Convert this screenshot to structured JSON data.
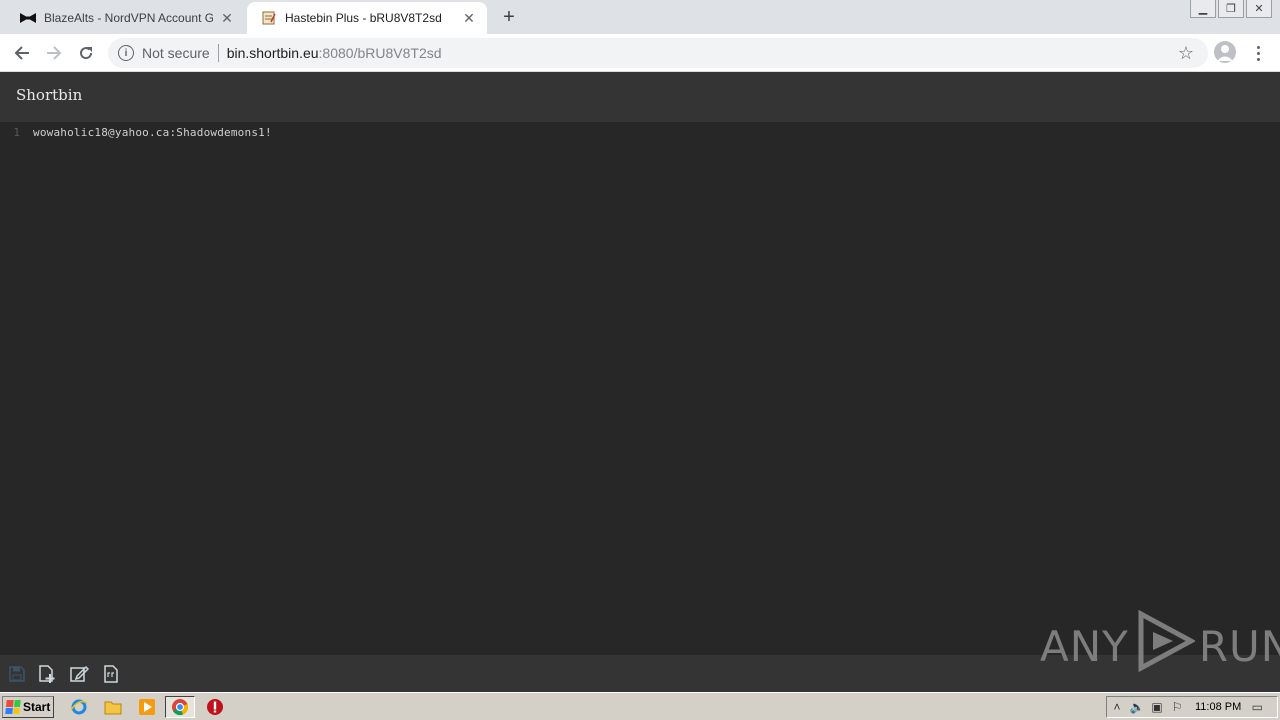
{
  "browser": {
    "tabs": [
      {
        "title": "BlazeAlts - NordVPN Account Genera",
        "active": false
      },
      {
        "title": "Hastebin Plus - bRU8V8T2sd",
        "active": true
      }
    ],
    "address": {
      "security_label": "Not secure",
      "host": "bin.shortbin.eu",
      "path": ":8080/bRU8V8T2sd"
    }
  },
  "page": {
    "brand": "Shortbin",
    "lines": [
      {
        "number": "1",
        "text": "wowaholic18@yahoo.ca:Shadowdemons1!"
      }
    ],
    "footer_tools": [
      "save-icon",
      "new-document-icon",
      "edit-icon",
      "raw-text-icon"
    ]
  },
  "watermark": {
    "left": "ANY",
    "right": "RUN"
  },
  "taskbar": {
    "start_label": "Start",
    "clock": "11:08 PM"
  },
  "colors": {
    "editor_bg": "#272727",
    "header_bg": "#343434",
    "text": "#cfcfcf"
  }
}
